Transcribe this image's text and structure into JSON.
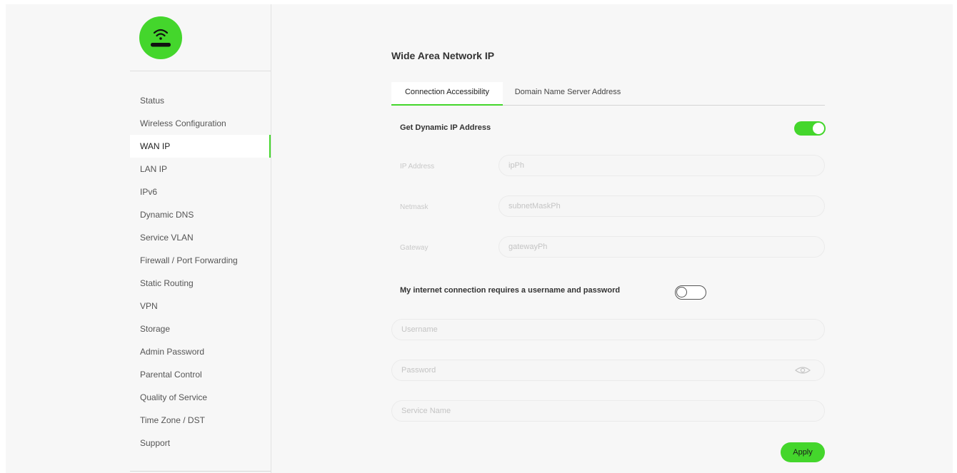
{
  "sidebar": {
    "logo_icon": "wifi-router-icon",
    "items": [
      {
        "label": "Status"
      },
      {
        "label": "Wireless Configuration"
      },
      {
        "label": "WAN IP"
      },
      {
        "label": "LAN IP"
      },
      {
        "label": "IPv6"
      },
      {
        "label": "Dynamic DNS"
      },
      {
        "label": "Service VLAN"
      },
      {
        "label": "Firewall / Port Forwarding"
      },
      {
        "label": "Static Routing"
      },
      {
        "label": "VPN"
      },
      {
        "label": "Storage"
      },
      {
        "label": "Admin Password"
      },
      {
        "label": "Parental Control"
      },
      {
        "label": "Quality of Service"
      },
      {
        "label": "Time Zone / DST"
      },
      {
        "label": "Support"
      }
    ],
    "active_index": 2
  },
  "main": {
    "title": "Wide Area Network IP",
    "tabs": [
      {
        "label": "Connection Accessibility",
        "active": true
      },
      {
        "label": "Domain Name Server Address",
        "active": false
      }
    ],
    "dynamic_ip": {
      "label": "Get Dynamic IP Address",
      "enabled": true
    },
    "fields": {
      "ip_address": {
        "label": "IP Address",
        "placeholder": "ipPh"
      },
      "netmask": {
        "label": "Netmask",
        "placeholder": "subnetMaskPh"
      },
      "gateway": {
        "label": "Gateway",
        "placeholder": "gatewayPh"
      }
    },
    "credentials": {
      "label": "My internet connection requires a username and password",
      "enabled": false
    },
    "username": {
      "placeholder": "Username"
    },
    "password": {
      "placeholder": "Password",
      "icon": "eye-icon"
    },
    "service_name": {
      "placeholder": "Service Name"
    },
    "apply_label": "Apply"
  },
  "colors": {
    "accent": "#44d62c",
    "background": "#f7f7f7"
  }
}
